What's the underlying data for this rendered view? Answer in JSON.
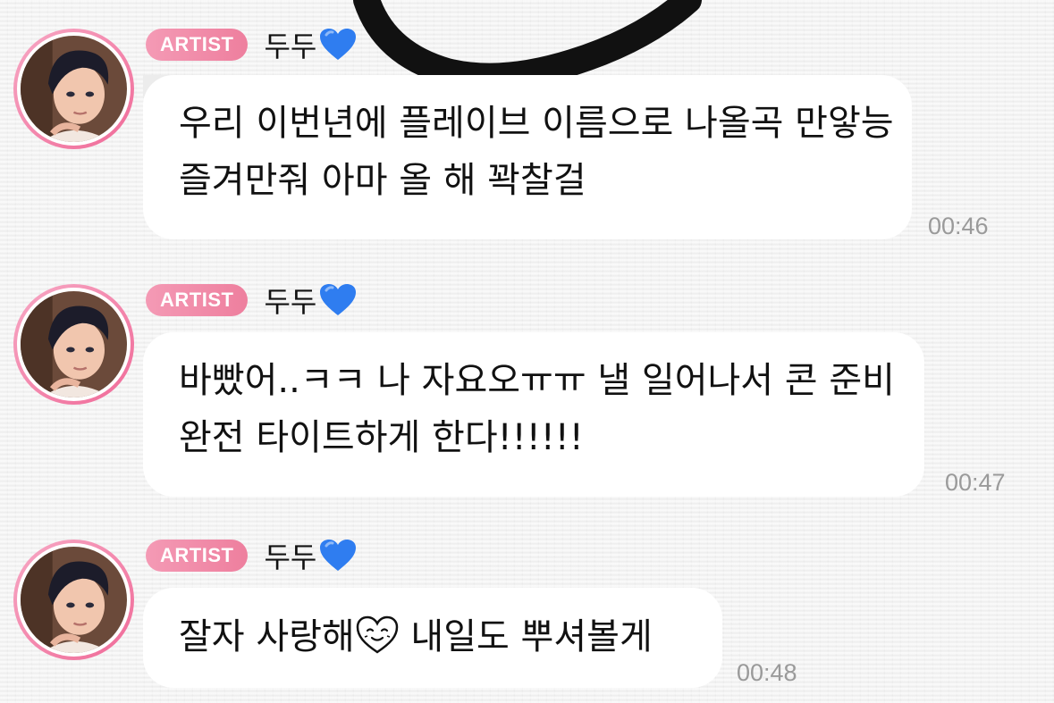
{
  "messages": [
    {
      "badge": "ARTIST",
      "sender": "두두",
      "lines": [
        "우리 이번년에 플레이브 이름으로 나올곡 만앟능",
        "즐겨만줘 아마 올 해 꽉찰걸"
      ],
      "time": "00:46"
    },
    {
      "badge": "ARTIST",
      "sender": "두두",
      "lines": [
        "바빴어..ㅋㅋ 나 자요오ㅠㅠ 낼 일어나서 콘 준비",
        "완전 타이트하게 한다!!!!!!"
      ],
      "time": "00:47"
    },
    {
      "badge": "ARTIST",
      "sender": "두두",
      "line_before_emoji": "잘자 사랑해",
      "line_after_emoji": " 내일도 뿌셔볼게",
      "time": "00:48"
    }
  ],
  "icons": {
    "avatar": "avatar-illustrated-man",
    "heart": "blue-heart-icon",
    "emoji": "heart-smile-icon"
  },
  "colors": {
    "badge": "#ef8aa9",
    "avatar_ring": "#f06a98",
    "heart": "#2f7df0",
    "bubble": "#ffffff",
    "timestamp": "#9a9a9a"
  }
}
